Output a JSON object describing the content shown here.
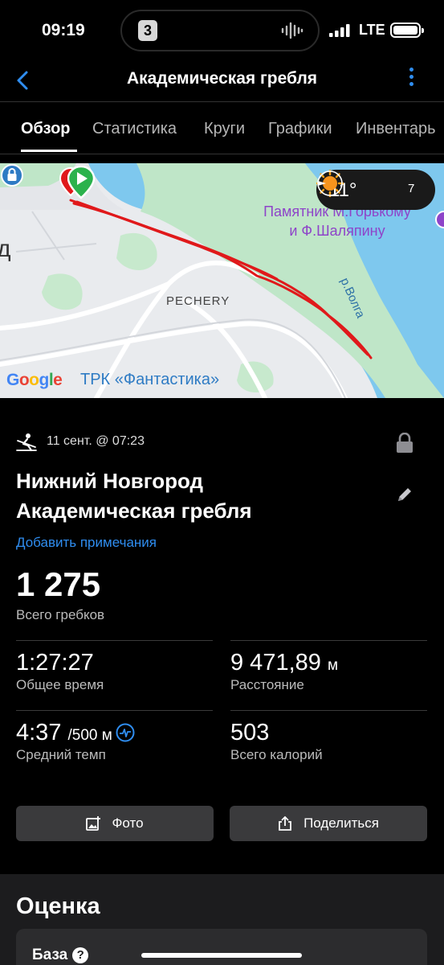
{
  "status": {
    "time": "09:19",
    "network": "LTE",
    "island_app": "3"
  },
  "nav": {
    "title": "Академическая гребля"
  },
  "tabs": [
    "Обзор",
    "Статистика",
    "Круги",
    "Графики",
    "Инвентарь"
  ],
  "map": {
    "weather_temp": "11°",
    "wind": "7",
    "monument_line1": "Памятник М.Горькому",
    "monument_line2": "и Ф.Шаляпину",
    "district": "PECHERY",
    "river": "р.Волга",
    "google": "Google",
    "poi": "ТРК «Фантастика»",
    "edge_letter": "д"
  },
  "activity": {
    "date": "11 сент. @ 07:23",
    "title_line1": "Нижний Новгород",
    "title_line2": "Академическая гребля",
    "add_note": "Добавить примечания",
    "strokes_value": "1 275",
    "strokes_label": "Всего гребков"
  },
  "stats": {
    "time_value": "1:27:27",
    "time_label": "Общее время",
    "distance_value": "9 471,89",
    "distance_unit": "м",
    "distance_label": "Расстояние",
    "pace_value": "4:37",
    "pace_unit": "/500 м",
    "pace_label": "Средний темп",
    "calories_value": "503",
    "calories_label": "Всего калорий"
  },
  "buttons": {
    "photo": "Фото",
    "share": "Поделиться"
  },
  "rating": {
    "title": "Оценка",
    "item": "База",
    "help": "?"
  },
  "colors": {
    "accent": "#2f8df0",
    "track": "#e0191b",
    "start_pin": "#2bb24c",
    "monument": "#8e44c9"
  }
}
